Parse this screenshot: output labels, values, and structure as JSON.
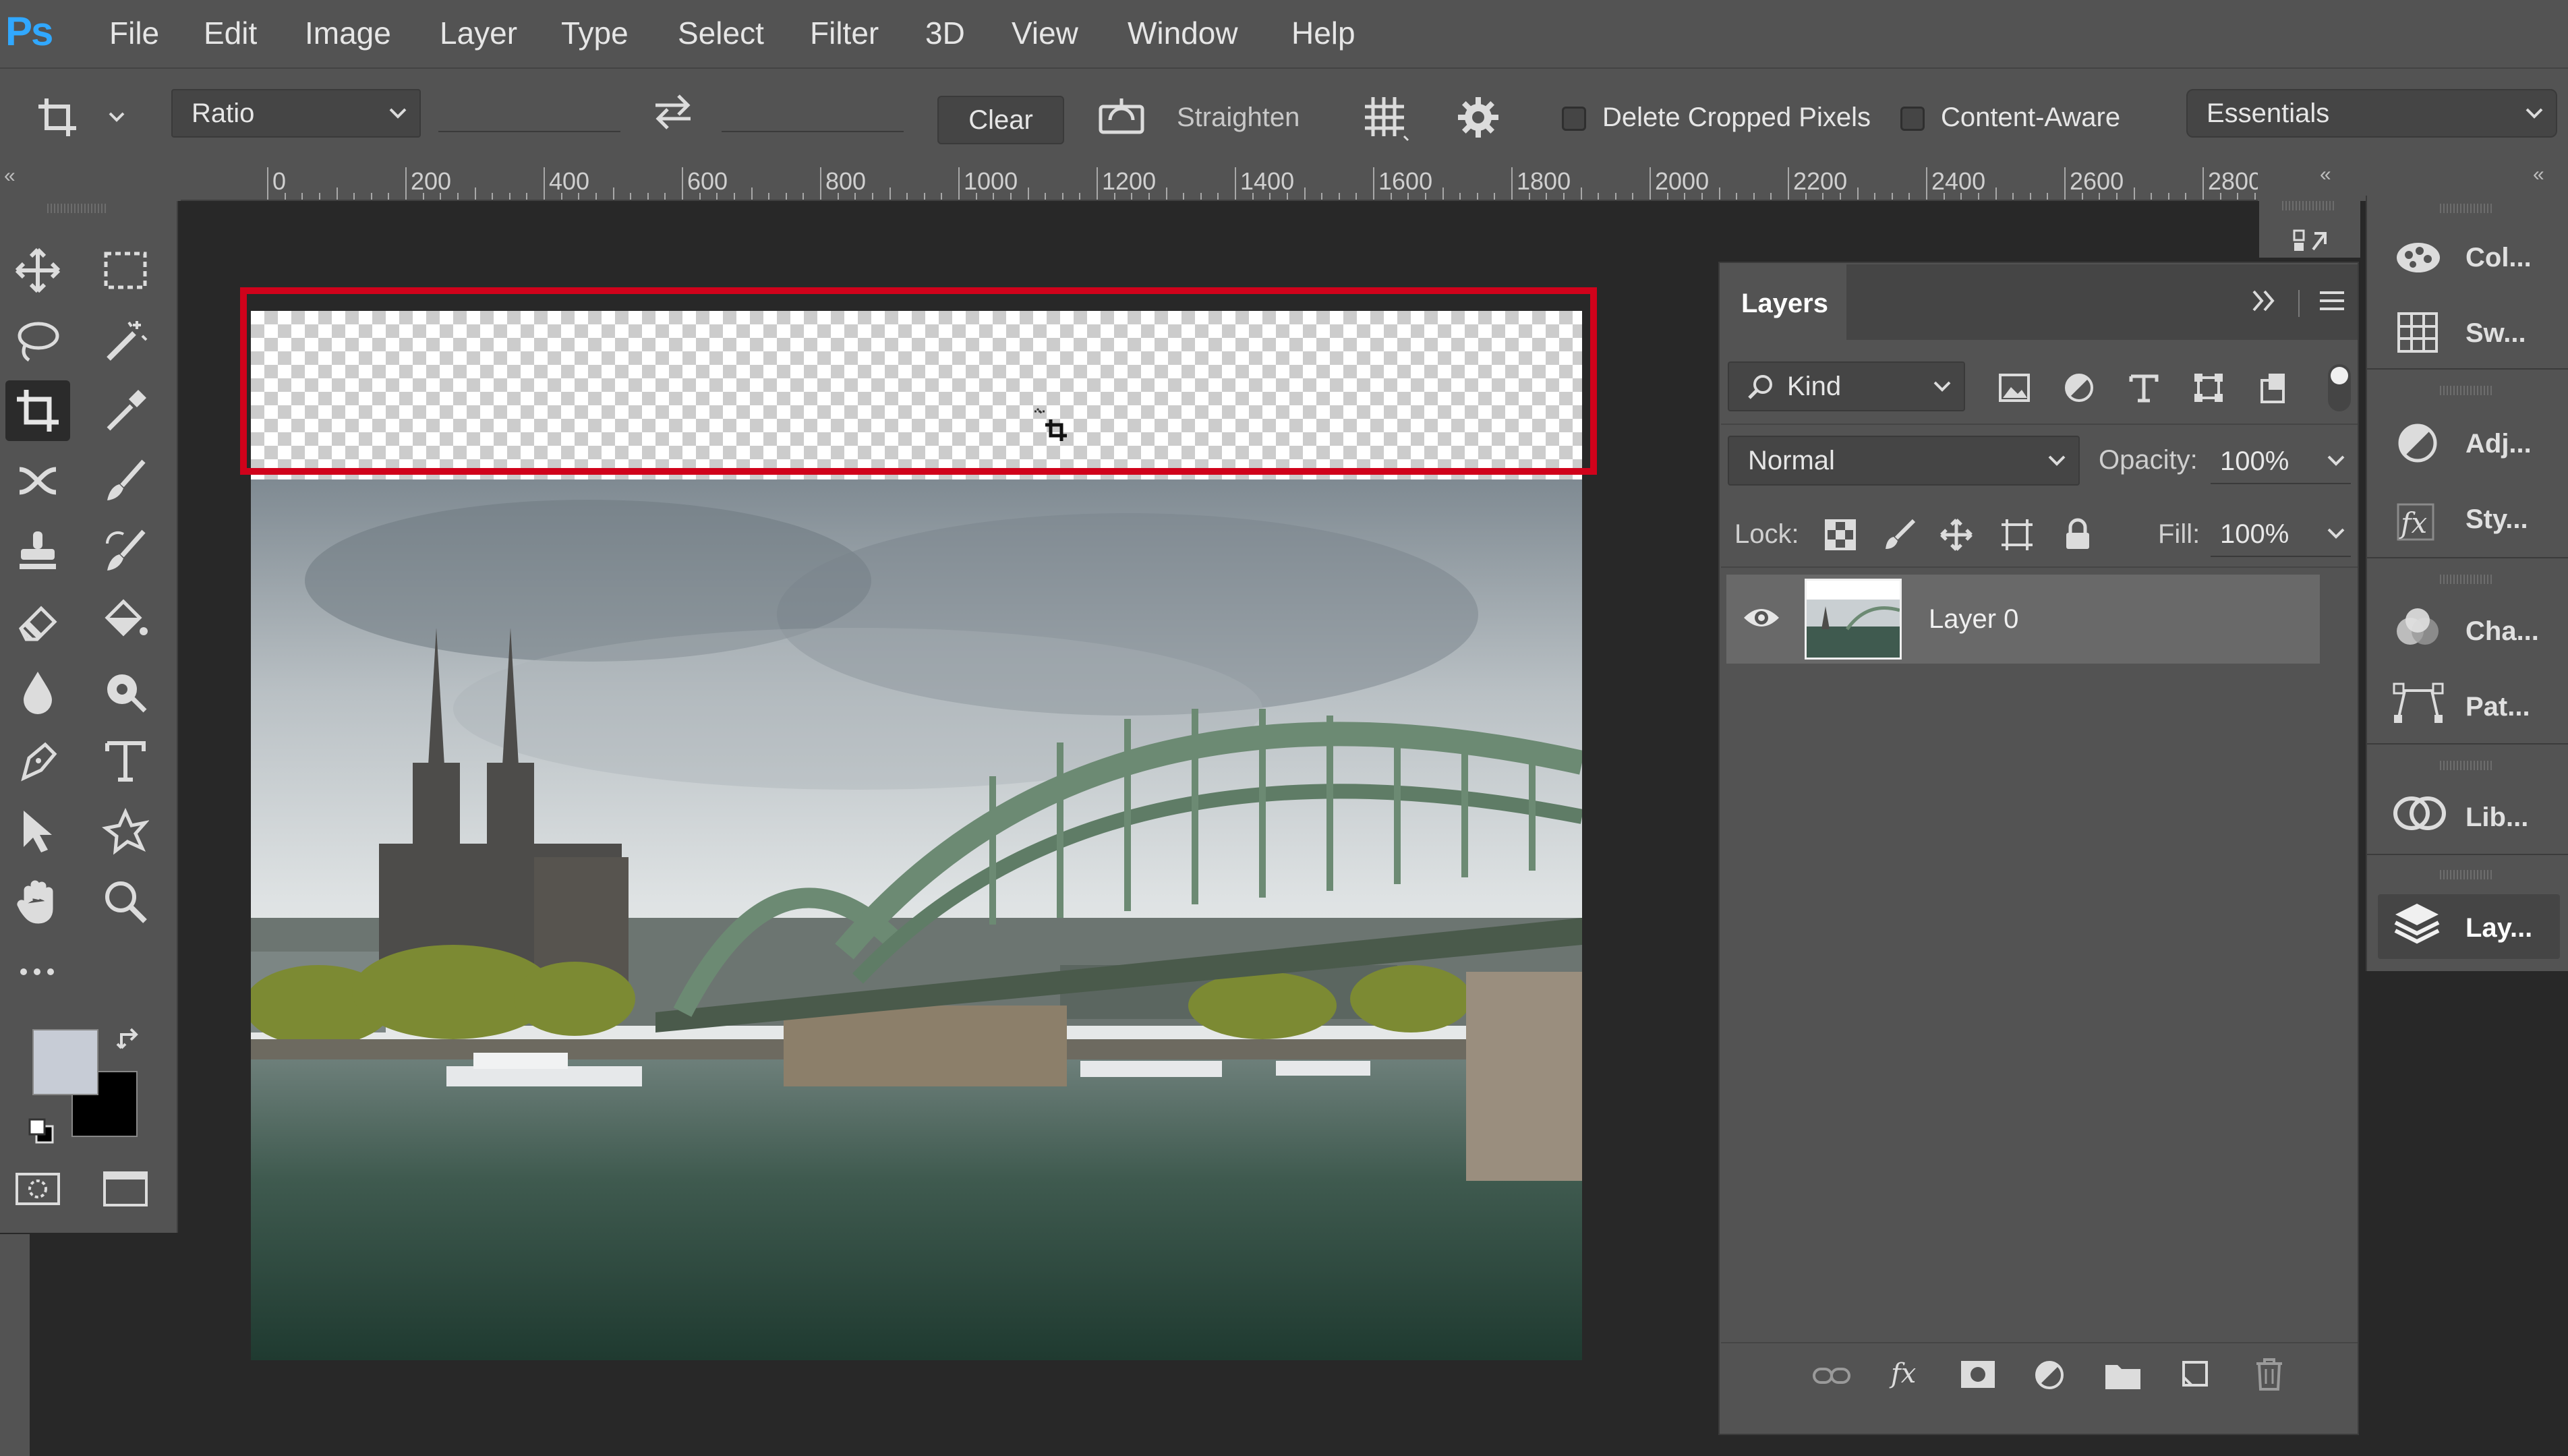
{
  "app": {
    "logo": "Ps"
  },
  "menu": [
    "File",
    "Edit",
    "Image",
    "Layer",
    "Type",
    "Select",
    "Filter",
    "3D",
    "View",
    "Window",
    "Help"
  ],
  "options": {
    "ratio_label": "Ratio",
    "clear_label": "Clear",
    "straighten_label": "Straighten",
    "delete_cropped_label": "Delete Cropped Pixels",
    "delete_cropped_checked": false,
    "content_aware_label": "Content-Aware",
    "content_aware_checked": false,
    "workspace": "Essentials"
  },
  "ruler": {
    "ticks": [
      "0",
      "200",
      "400",
      "600",
      "800",
      "1000",
      "1200",
      "1400",
      "1600",
      "1800",
      "2000",
      "2200",
      "2400",
      "2600",
      "2800"
    ]
  },
  "tools": {
    "foreground_color": "#c7ccd6",
    "background_color": "#000000"
  },
  "layers_panel": {
    "tab": "Layers",
    "filter_kind": "Kind",
    "blend_mode": "Normal",
    "opacity_label": "Opacity:",
    "opacity_value": "100%",
    "lock_label": "Lock:",
    "fill_label": "Fill:",
    "fill_value": "100%",
    "layers": [
      {
        "name": "Layer 0",
        "visible": true
      }
    ]
  },
  "right_dock": {
    "items": [
      "Col...",
      "Sw...",
      "Adj...",
      "Sty...",
      "Cha...",
      "Pat...",
      "Lib...",
      "Lay..."
    ]
  },
  "colors": {
    "crop_border": "#d0021b",
    "accent": "#31a8ff"
  }
}
